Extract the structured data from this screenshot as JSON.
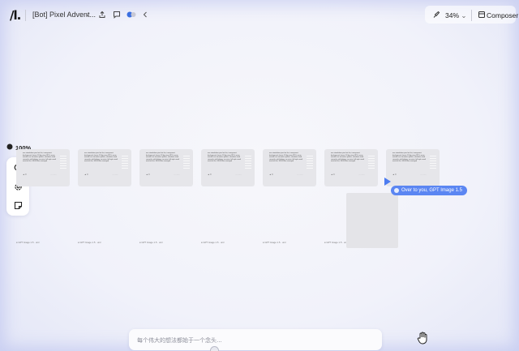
{
  "app": {
    "logo_text": "/l.",
    "title": "[Bot] Pixel Advent...",
    "zoom_top": "34%",
    "composer_label": "Composer"
  },
  "canvas": {
    "zoom_level": "100%",
    "card_text": "one standalone pixel art fire, transparent background, classic 32-bip store RPG, warm natural hue saturation palette, shadows sized correctly, soft lighting, no noise; full style result matches the 16x16 blue managed",
    "card_badge": "▲ 0",
    "card_meta": "·········",
    "generated_label": "● GPT Image 1.5 · uml",
    "cursor_tag": "Over to you, GPT Image 1.5"
  },
  "prompt": {
    "placeholder": "每个伟大的想法都始于一个念头..."
  },
  "icons": {
    "share": "share-icon",
    "comment": "comment-icon",
    "avatar": "avatar-icon",
    "search": "search-icon",
    "settings": "settings-icon",
    "note": "note-icon",
    "hand": "hand-icon"
  },
  "colors": {
    "accent": "#5b86f2",
    "card": "#e6e6ea"
  }
}
